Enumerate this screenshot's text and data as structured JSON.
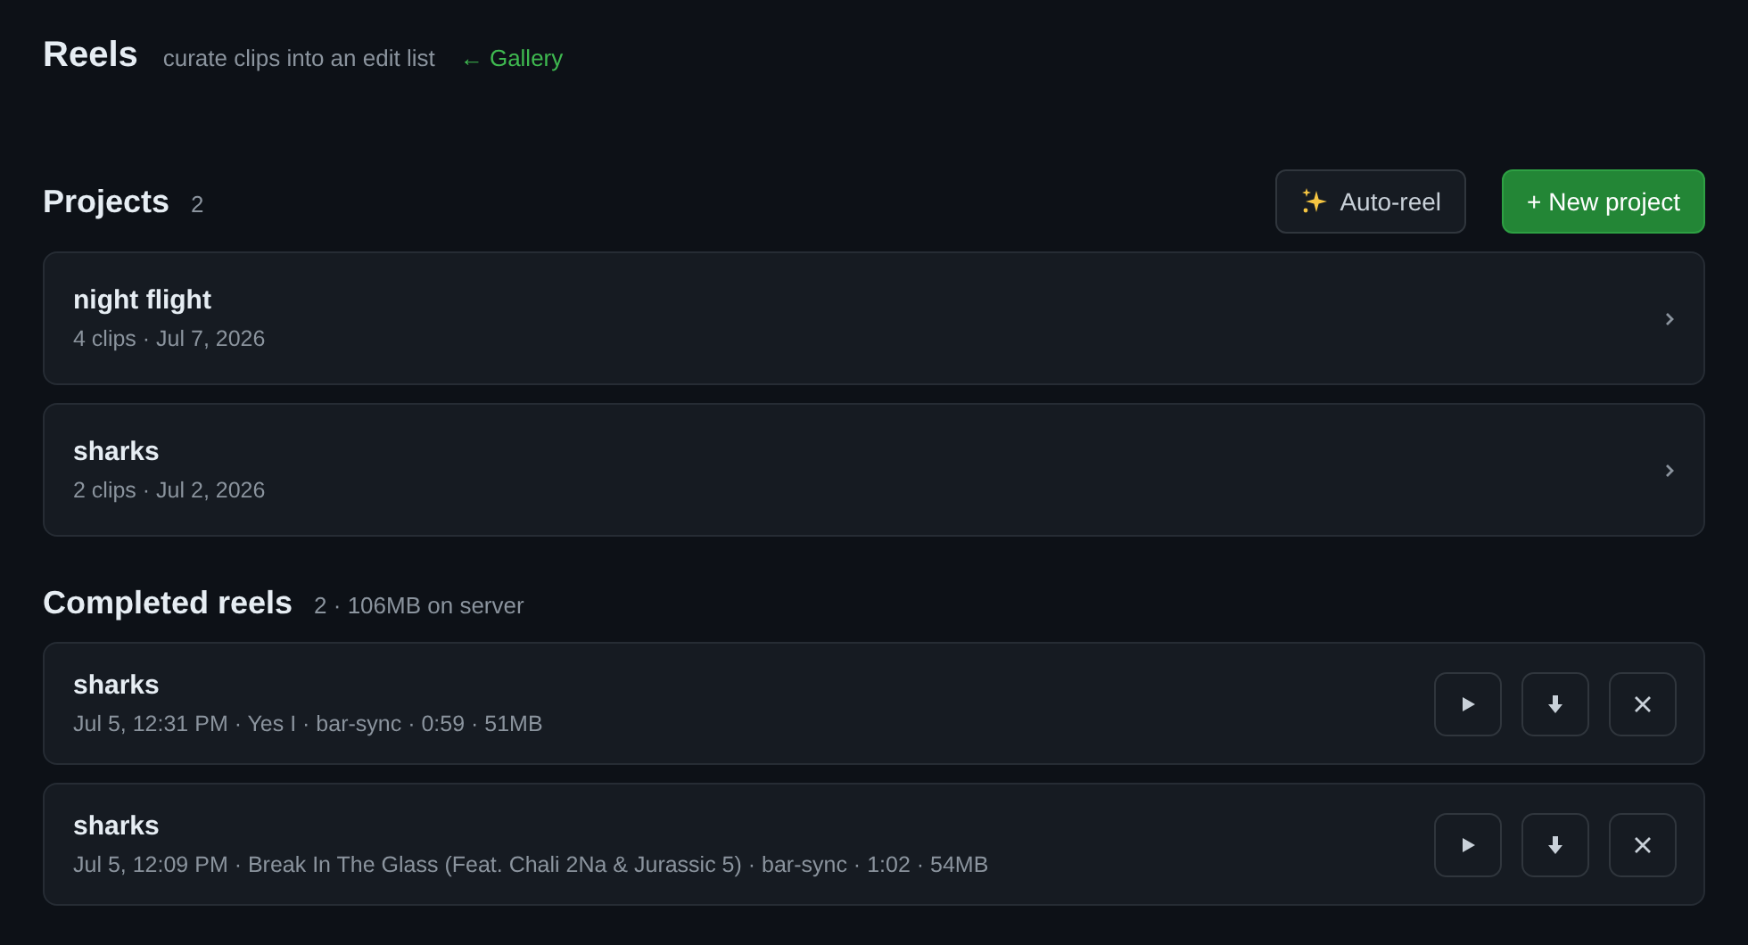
{
  "header": {
    "title": "Reels",
    "subtitle": "curate clips into an edit list",
    "back_link": "← Gallery"
  },
  "projects": {
    "title": "Projects",
    "count": "2",
    "buttons": [
      {
        "kind": "auto",
        "label": "Auto-reel"
      },
      {
        "kind": "new",
        "label": "+ New project"
      }
    ],
    "items": [
      {
        "name": "night flight",
        "meta": "4 clips · Jul 7, 2026"
      },
      {
        "name": "sharks",
        "meta": "2 clips · Jul 2, 2026"
      }
    ]
  },
  "completed": {
    "title": "Completed reels",
    "summary": "2 · 106MB on server",
    "items": [
      {
        "name": "sharks",
        "meta": "Jul 5, 12:31 PM · Yes I · bar-sync · 0:59 · 51MB"
      },
      {
        "name": "sharks",
        "meta": "Jul 5, 12:09 PM · Break In The Glass (Feat. Chali 2Na & Jurassic 5) · bar-sync · 1:02 · 54MB"
      }
    ]
  }
}
